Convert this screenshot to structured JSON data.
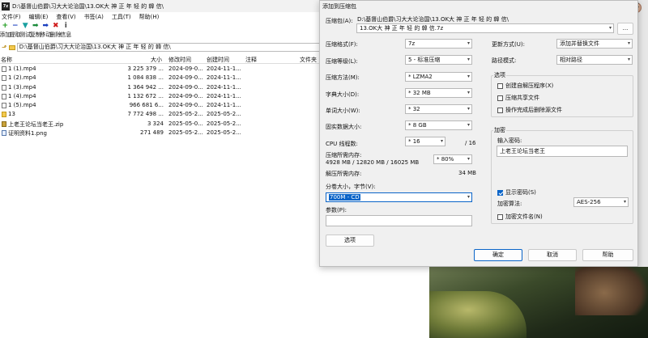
{
  "main": {
    "title": "D:\\基督山伯爵\\习大大论治国\\13.OK大 神 正 年 轻 的 韓 信\\",
    "app_icon": "7z",
    "menu": [
      "文件(F)",
      "编辑(E)",
      "查看(V)",
      "书签(A)",
      "工具(T)",
      "帮助(H)"
    ],
    "toolbar": [
      {
        "icon": "add-icon",
        "glyph": "+",
        "color": "#1a9a1a",
        "label": "添加"
      },
      {
        "icon": "extract-icon",
        "glyph": "−",
        "color": "#1a3fbf",
        "label": "提取"
      },
      {
        "icon": "test-icon",
        "glyph": "▼",
        "color": "#1aa0a0",
        "label": "测试"
      },
      {
        "icon": "copy-icon",
        "glyph": "➡",
        "color": "#1a8a3a",
        "label": "复制"
      },
      {
        "icon": "move-icon",
        "glyph": "➡",
        "color": "#1a3fbf",
        "label": "移动"
      },
      {
        "icon": "delete-icon",
        "glyph": "✖",
        "color": "#d01a1a",
        "label": "删除"
      },
      {
        "icon": "info-icon",
        "glyph": "i",
        "color": "#444444",
        "label": "信息"
      }
    ],
    "path": "D:\\基督山伯爵\\习大大论治国\\13.OK大 神 正 年 轻 的 韓 信\\",
    "columns": [
      "名称",
      "大小",
      "修改时间",
      "创建时间",
      "注释",
      "文件夹"
    ],
    "files": [
      {
        "name": "1 (1).mp4",
        "size": "3 225 379 ...",
        "modified": "2024-09-0...",
        "created": "2024-11-1...",
        "type": "file"
      },
      {
        "name": "1 (2).mp4",
        "size": "1 084 838 ...",
        "modified": "2024-09-0...",
        "created": "2024-11-1...",
        "type": "file"
      },
      {
        "name": "1 (3).mp4",
        "size": "1 364 942 ...",
        "modified": "2024-09-0...",
        "created": "2024-11-1...",
        "type": "file"
      },
      {
        "name": "1 (4).mp4",
        "size": "1 132 672 ...",
        "modified": "2024-09-0...",
        "created": "2024-11-1...",
        "type": "file"
      },
      {
        "name": "1 (5).mp4",
        "size": "966 681 6...",
        "modified": "2024-09-0...",
        "created": "2024-11-1...",
        "type": "file"
      },
      {
        "name": "13",
        "size": "7 772 498 ...",
        "modified": "2025-05-2...",
        "created": "2025-05-2...",
        "type": "folder"
      },
      {
        "name": "上老王论坛当老王.zip",
        "size": "3 324",
        "modified": "2025-05-0...",
        "created": "2025-05-2...",
        "type": "zip"
      },
      {
        "name": "证明资料1.png",
        "size": "271 489",
        "modified": "2025-05-2...",
        "created": "2025-05-2...",
        "type": "png"
      }
    ]
  },
  "dialog": {
    "title": "添加到压缩包",
    "archive_label": "压缩包(A):",
    "archive_dir": "D:\\基督山伯爵\\习大大论治国\\13.OK大 神 正 年 轻 的 韓 信\\",
    "archive_name": "13.OK大 神 正 年 轻 的 韓 信.7z",
    "browse": "...",
    "format_label": "压缩格式(F):",
    "format_value": "7z",
    "level_label": "压缩等级(L):",
    "level_value": "5 - 标准压缩",
    "method_label": "压缩方法(M):",
    "method_value": "* LZMA2",
    "dict_label": "字典大小(D):",
    "dict_value": "* 32 MB",
    "word_label": "单词大小(W):",
    "word_value": "* 32",
    "solid_label": "固实数据大小:",
    "solid_value": "* 8 GB",
    "threads_label": "CPU 线程数:",
    "threads_value": "* 16",
    "threads_total": "/ 16",
    "mem_comp_label": "压缩所需内存:",
    "mem_comp_detail": "4928 MB / 12820 MB / 16025 MB",
    "mem_comp_value": "* 80%",
    "mem_decomp_label": "解压所需内存:",
    "mem_decomp_value": "34 MB",
    "split_label": "分卷大小，字节(V):",
    "split_value": "700M - CD",
    "params_label": "参数(P):",
    "params_value": "",
    "options_button": "选项",
    "update_label": "更新方式(U):",
    "update_value": "添加并替换文件",
    "pathmode_label": "路径模式:",
    "pathmode_value": "相对路径",
    "options_group": "选项",
    "opt_sfx": "创建自解压程序(X)",
    "opt_shared": "压缩共享文件",
    "opt_delete": "操作完成后删除源文件",
    "encrypt_group": "加密",
    "password_label": "输入密码:",
    "password_value": "上老王论坛当老王",
    "show_password": "显示密码(S)",
    "enc_method_label": "加密算法:",
    "enc_method_value": "AES-256",
    "enc_names": "加密文件名(N)",
    "ok": "确定",
    "cancel": "取消",
    "help": "帮助"
  },
  "window": {
    "close_glyph": "✕"
  }
}
